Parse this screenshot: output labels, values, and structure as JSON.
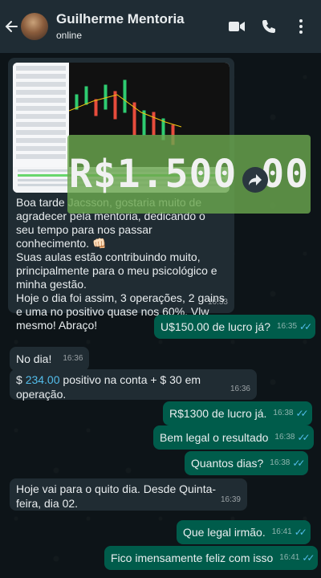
{
  "header": {
    "back_icon": "arrow-left-icon",
    "name": "Guilherme Mentoria",
    "status": "online",
    "icons": [
      "video-call-icon",
      "phone-icon",
      "more-vertical-icon"
    ]
  },
  "image_message": {
    "overlay_text": "R$1.500.00",
    "caption": [
      "Boa tarde Jacsson, gostaria muito de agradecer pela mentoria, dedicando o seu tempo para nos passar conhecimento. 👊🏻",
      "Suas aulas estão contribuindo muito, principalmente para o meu psicológico e minha gestão.",
      "Hoje o dia foi assim, 3 operações, 2 gains e uma no positivo quase nos 60%. Vlw mesmo! Abraço!"
    ],
    "time": "16:33"
  },
  "messages": [
    {
      "dir": "out",
      "text": "U$150.00 de lucro já?",
      "time": "16:35"
    },
    {
      "dir": "in",
      "text": "No dia!",
      "time": "16:36"
    },
    {
      "dir": "in",
      "text_prefix": "$ ",
      "text_highlight": "234.00",
      "text_suffix": " positivo na conta + $ 30 em operação.",
      "time": "16:36"
    },
    {
      "dir": "out",
      "text": "R$1300 de lucro já.",
      "time": "16:38"
    },
    {
      "dir": "out",
      "text": "Bem legal o resultado",
      "time": "16:38"
    },
    {
      "dir": "out",
      "text": "Quantos dias?",
      "time": "16:38"
    },
    {
      "dir": "in",
      "text": "Hoje vai para o quito dia. Desde Quinta-feira, dia 02.",
      "time": "16:39"
    },
    {
      "dir": "out",
      "text": "Que legal irmão.",
      "time": "16:41"
    },
    {
      "dir": "out",
      "text": "Fico imensamente feliz com isso",
      "time": "16:41"
    }
  ],
  "colors": {
    "header_bg": "#1f2c34",
    "incoming_bubble": "#202c33",
    "outgoing_bubble": "#005c4b",
    "read_ticks": "#53bdeb",
    "link_number": "#53bdeb",
    "overlay_green": "#6aa64e"
  }
}
